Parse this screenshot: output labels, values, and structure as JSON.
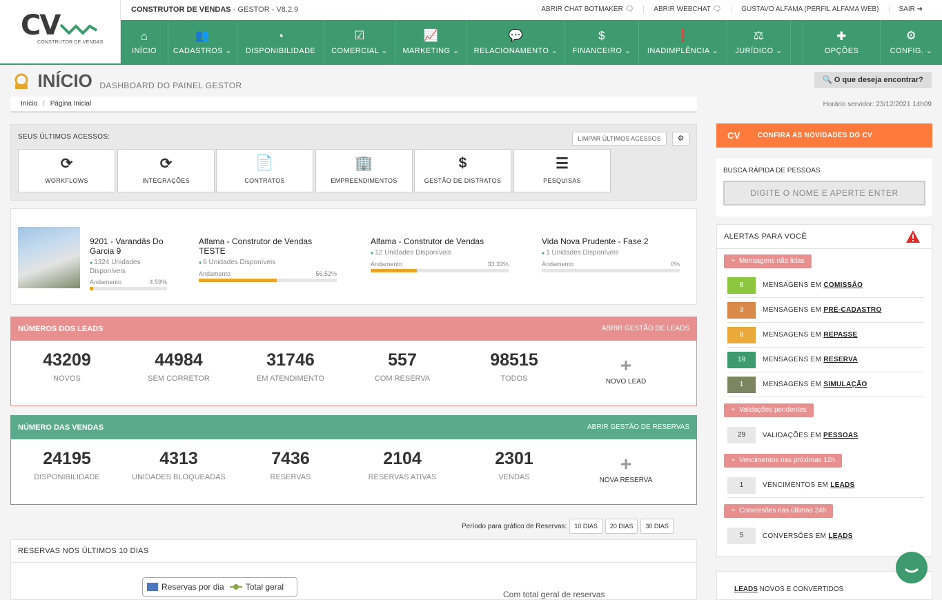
{
  "brand": {
    "logo": "CV",
    "logo_sub": "CONSTRUTOR DE VENDAS",
    "app_name": "CONSTRUTOR DE VENDAS",
    "app_suffix": " - GESTOR - V8.2.9"
  },
  "toplinks": [
    "ABRIR CHAT BOTMAKER 🗨",
    "ABRIR WEBCHAT 🗨",
    "GUSTAVO ALFAMA (PERFIL ALFAMA WEB)",
    "SAIR ➜"
  ],
  "nav": [
    {
      "icon": "⌂",
      "label": "INÍCIO"
    },
    {
      "icon": "👥",
      "label": "CADASTROS ⌄"
    },
    {
      "icon": "◔",
      "label": "DISPONIBILIDADE"
    },
    {
      "icon": "☑",
      "label": "COMERCIAL ⌄"
    },
    {
      "icon": "📈",
      "label": "MARKETING ⌄"
    },
    {
      "icon": "💬",
      "label": "RELACIONAMENTO ⌄"
    },
    {
      "icon": "$",
      "label": "FINANCEIRO ⌄"
    },
    {
      "icon": "❗",
      "label": "INADIMPLÊNCIA ⌄"
    },
    {
      "icon": "⚖",
      "label": "JURÍDICO ⌄"
    }
  ],
  "nav_right": [
    {
      "icon": "✚",
      "label": "OPÇÕES"
    },
    {
      "icon": "⚙",
      "label": "CONFIG. ⌄"
    }
  ],
  "page": {
    "title": "INÍCIO",
    "subtitle": "DASHBOARD DO PAINEL GESTOR",
    "search_btn": "🔍 O que deseja encontrar?"
  },
  "breadcrumb": {
    "home": "Início",
    "current": "Página Inicial",
    "server_time": "Horário servidor: 23/12/2021 14h09"
  },
  "access": {
    "label": "SEUS ÚLTIMOS ACESSOS:",
    "clear": "LIMPAR ÚLTIMOS ACESSOS",
    "gear": "⚙",
    "tiles": [
      {
        "icon": "⟳",
        "label": "WORKFLOWS"
      },
      {
        "icon": "⟳",
        "label": "INTEGRAÇÕES"
      },
      {
        "icon": "📄",
        "label": "CONTRATOS"
      },
      {
        "icon": "🏢",
        "label": "EMPREENDIMENTOS"
      },
      {
        "icon": "$",
        "label": "GESTÃO DE DISTRATOS"
      },
      {
        "icon": "☰",
        "label": "PESQUISAS"
      }
    ]
  },
  "empreendimentos": [
    {
      "name": "9201 - Varandãs Do Garcia 9",
      "units": "1324 Unidades Disponíveis",
      "progress_label": "Andamento",
      "progress": "4.59%",
      "pct": 4.59
    },
    {
      "name": "Alfama - Construtor de Vendas TESTE",
      "units": "6 Unidades Disponíveis",
      "progress_label": "Andamento",
      "progress": "56.52%",
      "pct": 56.52
    },
    {
      "name": "Alfama - Construtor de Vendas",
      "units": "12 Unidades Disponíveis",
      "progress_label": "Andamento",
      "progress": "33.33%",
      "pct": 33.33
    },
    {
      "name": "Vida Nova Prudente - Fase 2",
      "units": "1 Unidades Disponíveis",
      "progress_label": "Andamento",
      "progress": "0%",
      "pct": 0
    }
  ],
  "leads": {
    "title": "NÚMEROS DOS LEADS",
    "link": "ABRIR GESTÃO DE LEADS",
    "items": [
      {
        "v": "43209",
        "l": "NOVOS"
      },
      {
        "v": "44984",
        "l": "SEM CORRETOR"
      },
      {
        "v": "31746",
        "l": "EM ATENDIMENTO"
      },
      {
        "v": "557",
        "l": "COM RESERVA"
      },
      {
        "v": "98515",
        "l": "TODOS"
      }
    ],
    "add": "NOVO LEAD"
  },
  "vendas": {
    "title": "NÚMERO DAS VENDAS",
    "link": "ABRIR GESTÃO DE RESERVAS",
    "items": [
      {
        "v": "24195",
        "l": "DISPONIBILIDADE"
      },
      {
        "v": "4313",
        "l": "UNIDADES BLOQUEADAS"
      },
      {
        "v": "7436",
        "l": "RESERVAS"
      },
      {
        "v": "2104",
        "l": "RESERVAS ATIVAS"
      },
      {
        "v": "2301",
        "l": "VENDAS"
      }
    ],
    "add": "NOVA RESERVA"
  },
  "period": {
    "label": "Período para gráfico de Reservas:",
    "options": [
      "10 DIAS",
      "20 DIAS",
      "30 DIAS"
    ]
  },
  "reservas": {
    "title": "RESERVAS NOS ÚLTIMOS 10 DIAS",
    "legend_bar": "Reservas por dia",
    "legend_line": "Total geral",
    "chart_title": "Com total geral de reservas"
  },
  "news": "CONFIRA AS NOVIDADES DO CV",
  "busca": {
    "label": "BUSCA RÁPIDA DE PESSOAS",
    "placeholder": "DIGITE O NOME E APERTE ENTER"
  },
  "alerts": {
    "title": "ALERTAS PARA VOCÊ",
    "groups": [
      {
        "tag": "Mensagens não lidas",
        "rows": [
          {
            "n": "8",
            "pre": "MENSAGENS EM ",
            "key": "COMISSÃO",
            "color": "#8cc63f"
          },
          {
            "n": "3",
            "pre": "MENSAGENS EM ",
            "key": "PRÉ-CADASTRO",
            "color": "#d9894a"
          },
          {
            "n": "8",
            "pre": "MENSAGENS EM ",
            "key": "REPASSE",
            "color": "#eba93c"
          },
          {
            "n": "19",
            "pre": "MENSAGENS EM ",
            "key": "RESERVA",
            "color": "#3e9b6f"
          },
          {
            "n": "1",
            "pre": "MENSAGENS EM ",
            "key": "SIMULAÇÃO",
            "color": "#7d8560"
          }
        ]
      },
      {
        "tag": "Validações pendentes",
        "rows": [
          {
            "n": "29",
            "pre": "VALIDAÇÕES EM ",
            "key": "PESSOAS",
            "color": "#e8e8e8"
          }
        ]
      },
      {
        "tag": "Vencimentos nas próximas 12h",
        "rows": [
          {
            "n": "1",
            "pre": "VENCIMENTOS EM ",
            "key": "LEADS",
            "color": "#e8e8e8"
          }
        ]
      },
      {
        "tag": "Conversões nas últimas 24h",
        "rows": [
          {
            "n": "5",
            "pre": "CONVERSÕES EM ",
            "key": "LEADS",
            "color": "#e8e8e8"
          }
        ]
      }
    ]
  },
  "leads_box": {
    "key": "LEADS",
    "rest": " NOVOS E CONVERTIDOS"
  }
}
